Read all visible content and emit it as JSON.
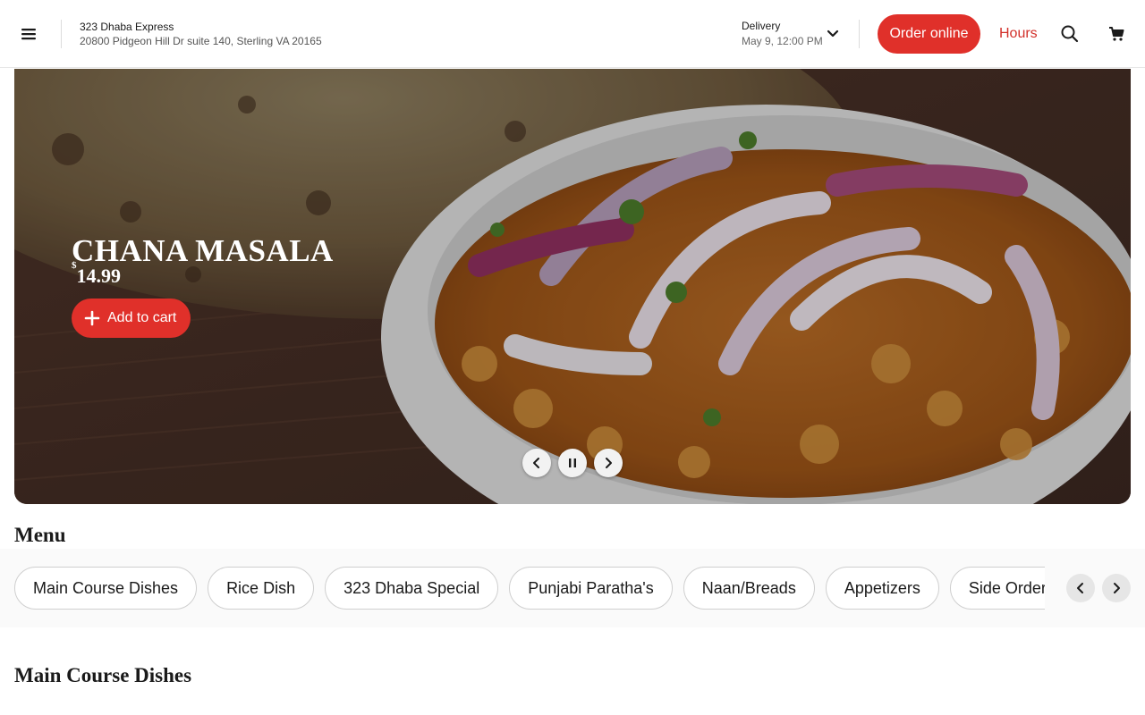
{
  "header": {
    "store_name": "323 Dhaba Express",
    "store_address": "20800 Pidgeon Hill Dr suite 140, Sterling VA 20165",
    "delivery_label": "Delivery",
    "delivery_time": "May 9, 12:00 PM",
    "order_button": "Order online",
    "hours_link": "Hours",
    "icons": [
      "hamburger-menu-icon",
      "chevron-down-icon",
      "search-icon",
      "cart-icon"
    ]
  },
  "hero": {
    "title": "CHANA MASALA",
    "price_currency": "$",
    "price": "14.99",
    "add_to_cart": "Add to cart",
    "controls": [
      "previous-slide",
      "pause",
      "next-slide"
    ]
  },
  "menu": {
    "heading": "Menu",
    "categories": [
      "Main Course Dishes",
      "Rice Dish",
      "323 Dhaba Special",
      "Punjabi Paratha's",
      "Naan/Breads",
      "Appetizers",
      "Side Orders"
    ],
    "section_heading": "Main Course Dishes"
  },
  "colors": {
    "accent": "#e0302a",
    "hours_text": "#d2302a"
  }
}
